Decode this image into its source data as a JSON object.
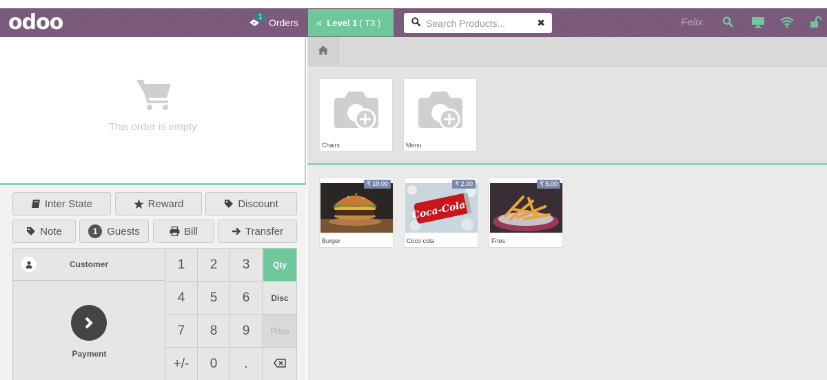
{
  "header": {
    "logo": "odoo",
    "orders": {
      "label": "Orders",
      "count": "1"
    },
    "floor": {
      "level": "Level 1",
      "table": "( T3 )"
    },
    "search": {
      "placeholder": "Search Products..."
    },
    "user": "Felix",
    "icons": [
      "search-icon",
      "display-icon",
      "wifi-icon",
      "unlock-icon"
    ],
    "accent_color": "#6ec89b",
    "bar_color": "#7b5a7c"
  },
  "order": {
    "empty_message": "This order is empty"
  },
  "controls": {
    "inter_state": "Inter State",
    "reward": "Reward",
    "discount": "Discount",
    "note": "Note",
    "guests_count": "1",
    "guests": "Guests",
    "bill": "Bill",
    "transfer": "Transfer"
  },
  "numpad": {
    "customer": "Customer",
    "payment": "Payment",
    "keys": [
      "1",
      "2",
      "3",
      "4",
      "5",
      "6",
      "7",
      "8",
      "9",
      "+/-",
      "0",
      "."
    ],
    "modes": {
      "qty": "Qty",
      "disc": "Disc",
      "price": "Price"
    },
    "active_mode": "Qty"
  },
  "categories": [
    {
      "name": "Chairs"
    },
    {
      "name": "Menu"
    }
  ],
  "products": [
    {
      "name": "Burger",
      "price": "₹ 10.00"
    },
    {
      "name": "Coco cola",
      "price": "₹ 2.00"
    },
    {
      "name": "Fries",
      "price": "₹ 5.00"
    }
  ],
  "product_image_labels": {
    "coca_cola_logo": "Coca-Cola"
  }
}
